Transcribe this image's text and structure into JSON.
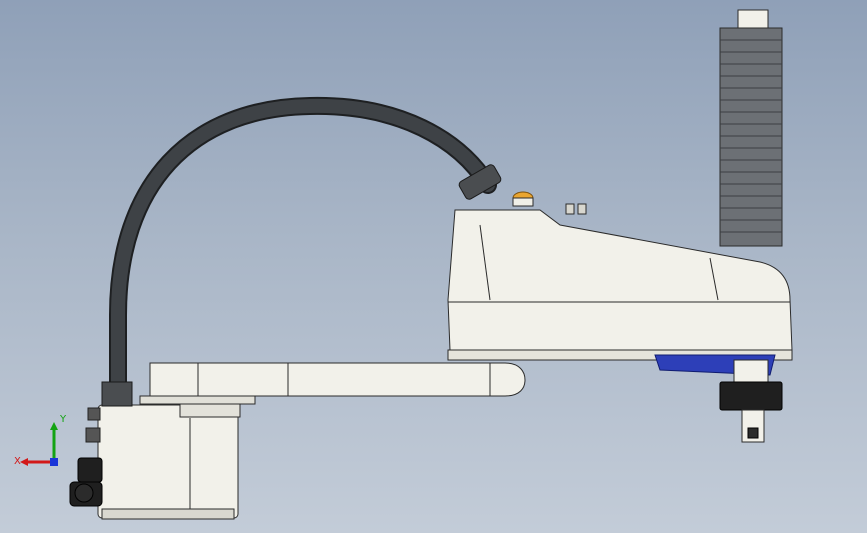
{
  "viewport": {
    "background_top": "#8fa0b8",
    "background_bottom": "#c3ccd8"
  },
  "model": {
    "subject": "SCARA robot",
    "colors": {
      "body": "#f2f1ea",
      "outline": "#2b2b2b",
      "cable": "#3a3d40",
      "bellows": "#6c7075",
      "accent_blue": "#2d3fb8",
      "indicator_lamp": "#e9a530"
    }
  },
  "triad": {
    "x_label": "X",
    "y_label": "Y",
    "x_color": "#d21818",
    "y_color": "#13a313",
    "z_color": "#1a35d8"
  }
}
